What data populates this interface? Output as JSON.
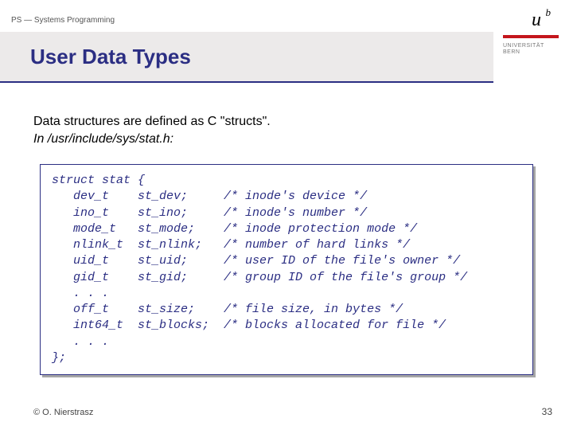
{
  "header": {
    "course": "PS — Systems Programming"
  },
  "title": "User Data Types",
  "logo": {
    "u": "u",
    "b": "b",
    "uni_l1": "UNIVERSITÄT",
    "uni_l2": "BERN"
  },
  "body": {
    "line1": "Data structures are defined as C \"structs\".",
    "line2": "In /usr/include/sys/stat.h:"
  },
  "code": "struct stat {\n   dev_t    st_dev;     /* inode's device */\n   ino_t    st_ino;     /* inode's number */\n   mode_t   st_mode;    /* inode protection mode */\n   nlink_t  st_nlink;   /* number of hard links */\n   uid_t    st_uid;     /* user ID of the file's owner */\n   gid_t    st_gid;     /* group ID of the file's group */\n   . . .\n   off_t    st_size;    /* file size, in bytes */\n   int64_t  st_blocks;  /* blocks allocated for file */\n   . . .\n};",
  "footer": {
    "copyright": "© O. Nierstrasz",
    "page": "33"
  }
}
